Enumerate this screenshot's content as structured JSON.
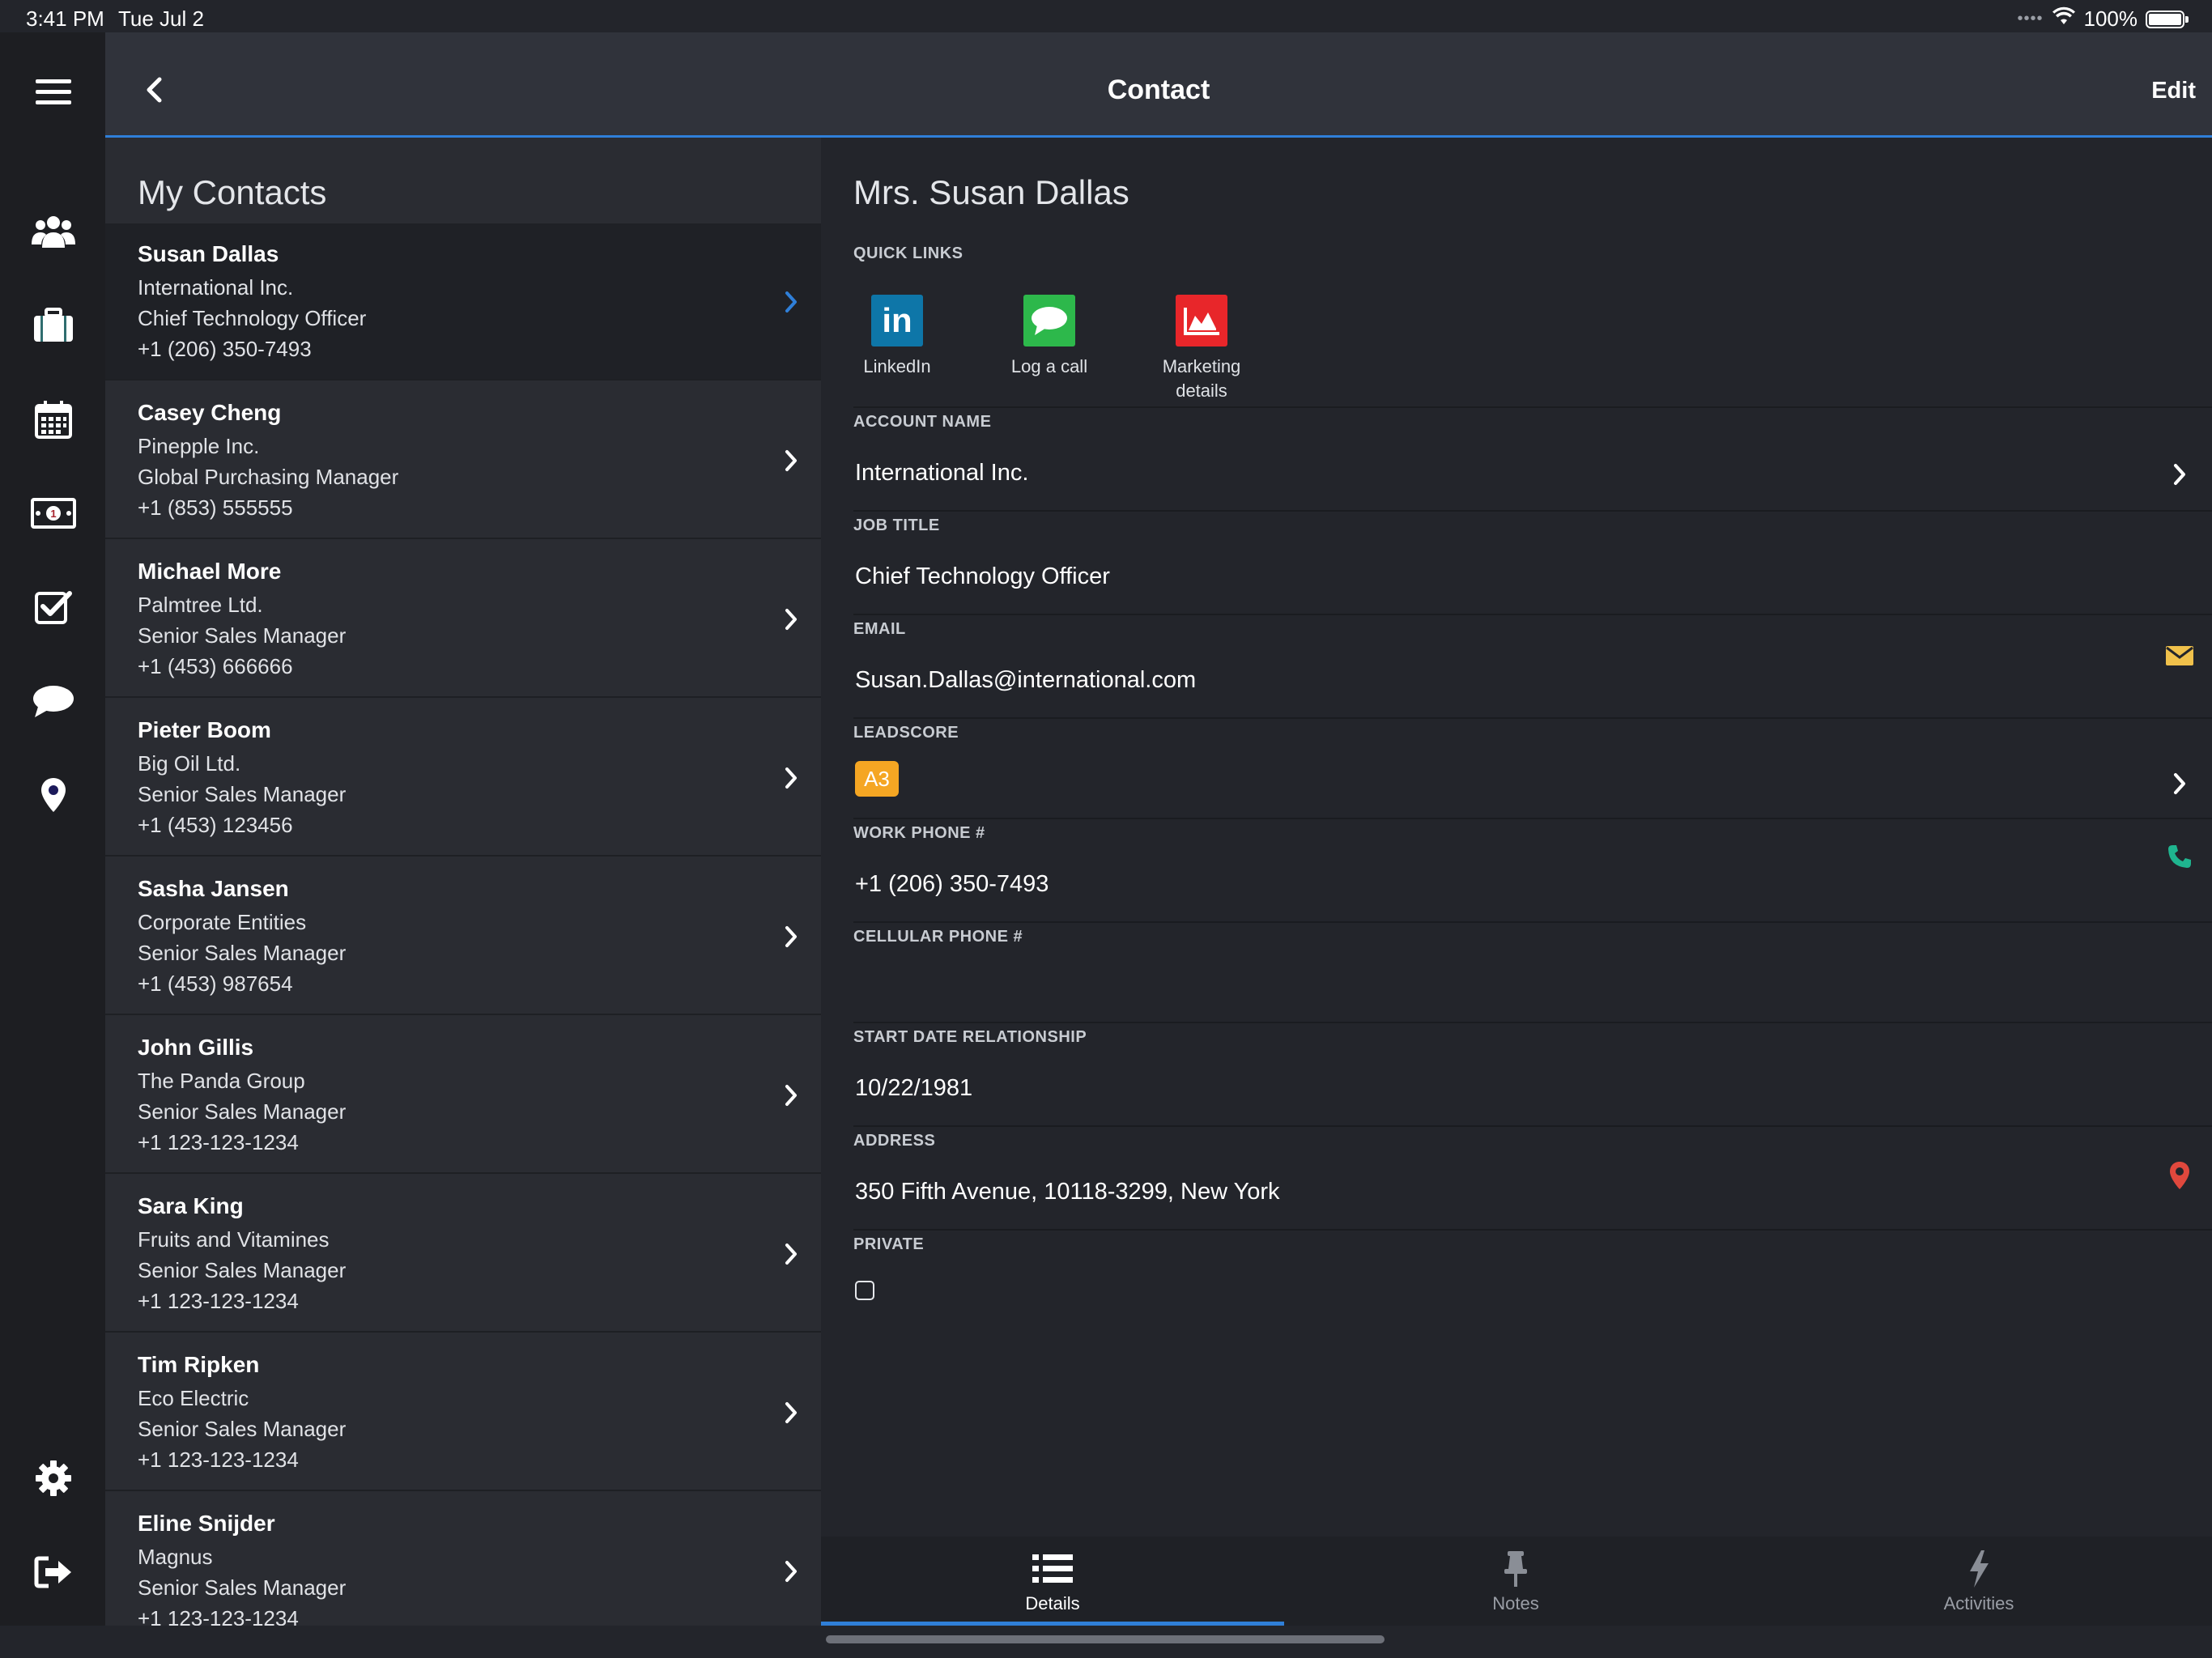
{
  "status_bar": {
    "time": "3:41 PM",
    "date": "Tue Jul 2",
    "battery": "100%"
  },
  "nav": {
    "title": "Contact",
    "edit_label": "Edit"
  },
  "rail": {
    "items": [
      {
        "name": "contacts",
        "color": "#2e8b45"
      },
      {
        "name": "accounts",
        "color": "#2f6d6f"
      },
      {
        "name": "calendar",
        "color": "#b53337"
      },
      {
        "name": "opportunities",
        "color": "#a8252f"
      },
      {
        "name": "tasks",
        "color": "#2c57a8"
      },
      {
        "name": "messages",
        "color": "#3a2363"
      },
      {
        "name": "locations",
        "color": "#1c1a5a"
      }
    ]
  },
  "list": {
    "title": "My Contacts",
    "contacts": [
      {
        "name": "Susan Dallas",
        "company": "International Inc.",
        "title": "Chief Technology Officer",
        "phone": "+1 (206) 350-7493"
      },
      {
        "name": "Casey Cheng",
        "company": "Pinepple Inc.",
        "title": "Global Purchasing Manager",
        "phone": "+1 (853) 555555"
      },
      {
        "name": "Michael More",
        "company": "Palmtree Ltd.",
        "title": "Senior Sales Manager",
        "phone": "+1 (453) 666666"
      },
      {
        "name": "Pieter Boom",
        "company": "Big Oil Ltd.",
        "title": "Senior Sales Manager",
        "phone": "+1 (453) 123456"
      },
      {
        "name": "Sasha Jansen",
        "company": "Corporate Entities",
        "title": "Senior Sales Manager",
        "phone": "+1 (453) 987654"
      },
      {
        "name": "John Gillis",
        "company": "The Panda Group",
        "title": "Senior Sales Manager",
        "phone": "+1 123-123-1234"
      },
      {
        "name": "Sara King",
        "company": "Fruits and Vitamines",
        "title": "Senior Sales Manager",
        "phone": "+1 123-123-1234"
      },
      {
        "name": "Tim Ripken",
        "company": "Eco Electric",
        "title": "Senior Sales Manager",
        "phone": "+1 123-123-1234"
      },
      {
        "name": "Eline Snijder",
        "company": "Magnus",
        "title": "Senior Sales Manager",
        "phone": "+1 123-123-1234"
      }
    ]
  },
  "detail": {
    "name": "Mrs. Susan Dallas",
    "quick_links_label": "QUICK LINKS",
    "quick_links": [
      {
        "label": "LinkedIn",
        "icon": "linkedin-icon",
        "color": "#0e76a8"
      },
      {
        "label": "Log a call",
        "icon": "speech-bubble-icon",
        "color": "#2db84b"
      },
      {
        "label": "Marketing details",
        "icon": "area-chart-icon",
        "color": "#e8262a"
      }
    ],
    "fields": {
      "account_name": {
        "label": "ACCOUNT NAME",
        "value": "International Inc."
      },
      "job_title": {
        "label": "JOB TITLE",
        "value": "Chief Technology Officer"
      },
      "email": {
        "label": "EMAIL",
        "value": "Susan.Dallas@international.com"
      },
      "leadscore": {
        "label": "LEADSCORE",
        "value": "A3",
        "color": "#f5a623"
      },
      "work_phone": {
        "label": "WORK PHONE #",
        "value": "+1 (206) 350-7493"
      },
      "cellular_phone": {
        "label": "CELLULAR PHONE #",
        "value": ""
      },
      "start_date": {
        "label": "START DATE RELATIONSHIP",
        "value": "10/22/1981"
      },
      "address": {
        "label": "ADDRESS",
        "value": "350 Fifth Avenue, 10118-3299, New York"
      },
      "private": {
        "label": "PRIVATE",
        "checked": false
      }
    }
  },
  "tabs": [
    {
      "label": "Details",
      "active": true
    },
    {
      "label": "Notes",
      "active": false
    },
    {
      "label": "Activities",
      "active": false
    }
  ],
  "colors": {
    "accent": "#2f7fd8",
    "email_icon": "#f0c14b",
    "phone_icon": "#1fb58f",
    "map_pin": "#e0483d"
  }
}
